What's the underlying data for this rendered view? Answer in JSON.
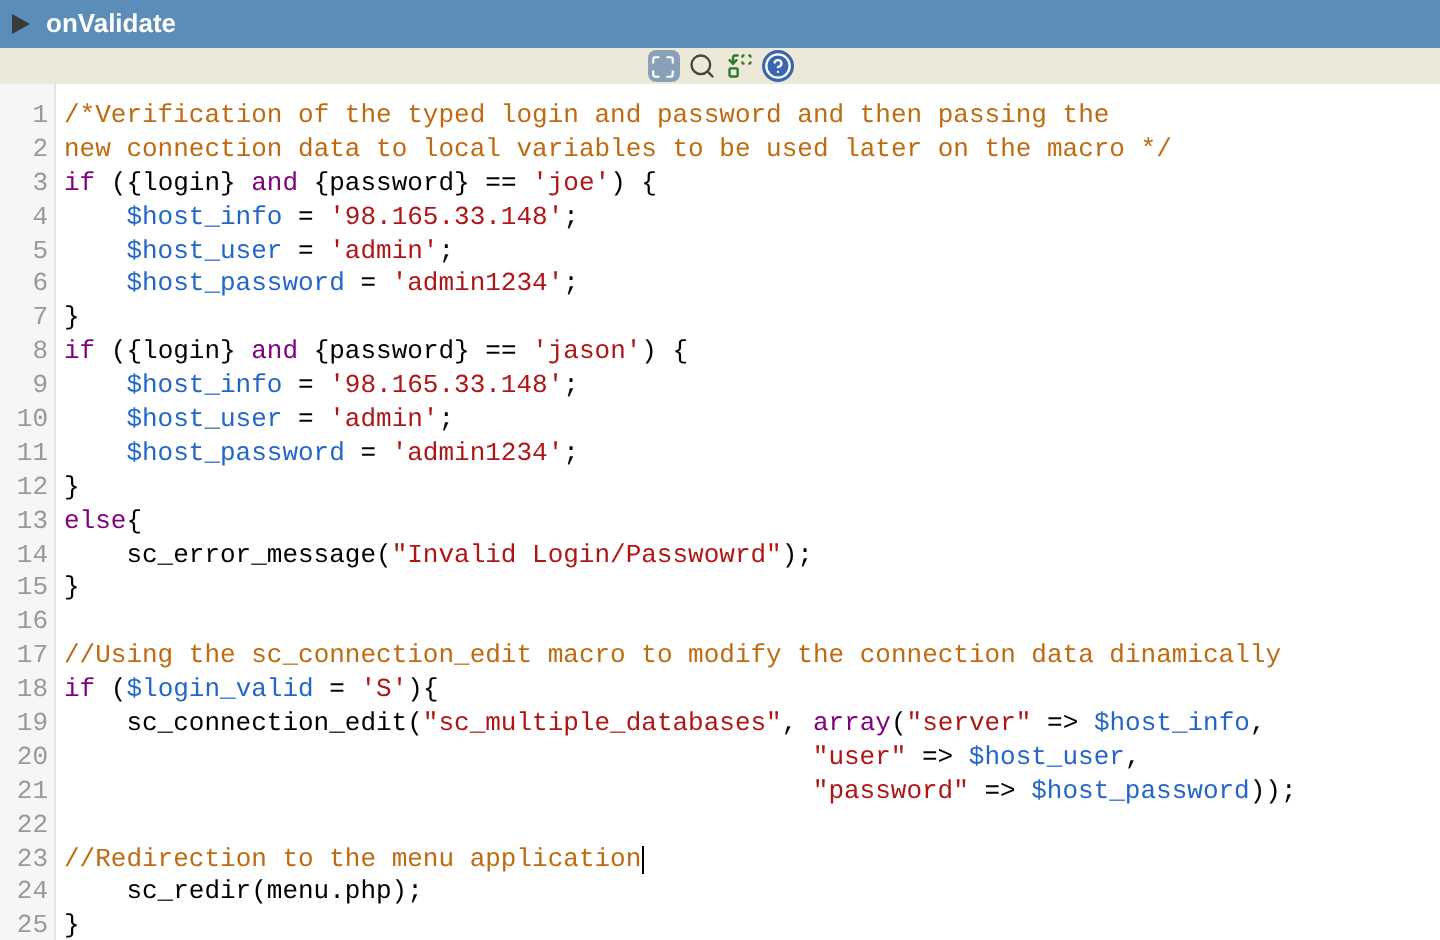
{
  "panel": {
    "title": "onValidate"
  },
  "editor": {
    "lines": [
      {
        "number": "1",
        "tokens": [
          {
            "kind": "comment",
            "text": "/*Verification of the typed login and password and then passing the"
          }
        ]
      },
      {
        "number": "2",
        "tokens": [
          {
            "kind": "comment",
            "text": "new connection data to local variables to be used later on the macro */"
          }
        ]
      },
      {
        "number": "3",
        "tokens": [
          {
            "kind": "keyword",
            "text": "if"
          },
          {
            "kind": "plain",
            "text": " ({login} "
          },
          {
            "kind": "keyword",
            "text": "and"
          },
          {
            "kind": "plain",
            "text": " {password} == "
          },
          {
            "kind": "string",
            "text": "'joe'"
          },
          {
            "kind": "plain",
            "text": ") {"
          }
        ]
      },
      {
        "number": "4",
        "indented": true,
        "tokens": [
          {
            "kind": "variable",
            "text": "$host_info"
          },
          {
            "kind": "plain",
            "text": " = "
          },
          {
            "kind": "string",
            "text": "'98.165.33.148'"
          },
          {
            "kind": "plain",
            "text": ";"
          }
        ]
      },
      {
        "number": "5",
        "indented": true,
        "tokens": [
          {
            "kind": "variable",
            "text": "$host_user"
          },
          {
            "kind": "plain",
            "text": " = "
          },
          {
            "kind": "string",
            "text": "'admin'"
          },
          {
            "kind": "plain",
            "text": ";"
          }
        ]
      },
      {
        "number": "6",
        "indented": true,
        "tokens": [
          {
            "kind": "variable",
            "text": "$host_password"
          },
          {
            "kind": "plain",
            "text": " = "
          },
          {
            "kind": "string",
            "text": "'admin1234'"
          },
          {
            "kind": "plain",
            "text": ";"
          }
        ]
      },
      {
        "number": "7",
        "tokens": [
          {
            "kind": "plain",
            "text": "}"
          }
        ]
      },
      {
        "number": "8",
        "tokens": [
          {
            "kind": "keyword",
            "text": "if"
          },
          {
            "kind": "plain",
            "text": " ({login} "
          },
          {
            "kind": "keyword",
            "text": "and"
          },
          {
            "kind": "plain",
            "text": " {password} == "
          },
          {
            "kind": "string",
            "text": "'jason'"
          },
          {
            "kind": "plain",
            "text": ") {"
          }
        ]
      },
      {
        "number": "9",
        "indented": true,
        "tokens": [
          {
            "kind": "variable",
            "text": "$host_info"
          },
          {
            "kind": "plain",
            "text": " = "
          },
          {
            "kind": "string",
            "text": "'98.165.33.148'"
          },
          {
            "kind": "plain",
            "text": ";"
          }
        ]
      },
      {
        "number": "10",
        "indented": true,
        "tokens": [
          {
            "kind": "variable",
            "text": "$host_user"
          },
          {
            "kind": "plain",
            "text": " = "
          },
          {
            "kind": "string",
            "text": "'admin'"
          },
          {
            "kind": "plain",
            "text": ";"
          }
        ]
      },
      {
        "number": "11",
        "indented": true,
        "tokens": [
          {
            "kind": "variable",
            "text": "$host_password"
          },
          {
            "kind": "plain",
            "text": " = "
          },
          {
            "kind": "string",
            "text": "'admin1234'"
          },
          {
            "kind": "plain",
            "text": ";"
          }
        ]
      },
      {
        "number": "12",
        "tokens": [
          {
            "kind": "plain",
            "text": "}"
          }
        ]
      },
      {
        "number": "13",
        "tokens": [
          {
            "kind": "keyword",
            "text": "else"
          },
          {
            "kind": "plain",
            "text": "{"
          }
        ]
      },
      {
        "number": "14",
        "indented": true,
        "tokens": [
          {
            "kind": "plain",
            "text": "sc_error_message("
          },
          {
            "kind": "string",
            "text": "\"Invalid Login/Passwowrd\""
          },
          {
            "kind": "plain",
            "text": ");"
          }
        ]
      },
      {
        "number": "15",
        "tokens": [
          {
            "kind": "plain",
            "text": "}"
          }
        ]
      },
      {
        "number": "16"
      },
      {
        "number": "17",
        "tokens": [
          {
            "kind": "comment",
            "text": "//Using the sc_connection_edit macro to modify the connection data dinamically"
          }
        ]
      },
      {
        "number": "18",
        "tokens": [
          {
            "kind": "keyword",
            "text": "if"
          },
          {
            "kind": "plain",
            "text": " ("
          },
          {
            "kind": "variable",
            "text": "$login_valid"
          },
          {
            "kind": "plain",
            "text": " = "
          },
          {
            "kind": "string",
            "text": "'S'"
          },
          {
            "kind": "plain",
            "text": "){"
          }
        ]
      },
      {
        "number": "19",
        "indented": true,
        "tokens": [
          {
            "kind": "plain",
            "text": "sc_connection_edit("
          },
          {
            "kind": "string",
            "text": "\"sc_multiple_databases\""
          },
          {
            "kind": "plain",
            "text": ", "
          },
          {
            "kind": "keyword",
            "text": "array"
          },
          {
            "kind": "plain",
            "text": "("
          },
          {
            "kind": "string",
            "text": "\"server\""
          },
          {
            "kind": "plain",
            "text": " => "
          },
          {
            "kind": "variable",
            "text": "$host_info"
          },
          {
            "kind": "plain",
            "text": ","
          }
        ]
      },
      {
        "number": "20",
        "continued": true,
        "tokens": [
          {
            "kind": "string",
            "text": "\"user\""
          },
          {
            "kind": "plain",
            "text": " => "
          },
          {
            "kind": "variable",
            "text": "$host_user"
          },
          {
            "kind": "plain",
            "text": ","
          }
        ]
      },
      {
        "number": "21",
        "continued": true,
        "tokens": [
          {
            "kind": "string",
            "text": "\"password\""
          },
          {
            "kind": "plain",
            "text": " => "
          },
          {
            "kind": "variable",
            "text": "$host_password"
          },
          {
            "kind": "plain",
            "text": "));"
          }
        ]
      },
      {
        "number": "22"
      },
      {
        "number": "23",
        "cursor": true,
        "tokens": [
          {
            "kind": "comment",
            "text": "//Redirection to the menu application"
          }
        ]
      },
      {
        "number": "24",
        "indented": true,
        "tokens": [
          {
            "kind": "plain",
            "text": "sc_redir(menu.php);"
          }
        ]
      },
      {
        "number": "25",
        "tokens": [
          {
            "kind": "plain",
            "text": "}"
          }
        ]
      }
    ]
  }
}
